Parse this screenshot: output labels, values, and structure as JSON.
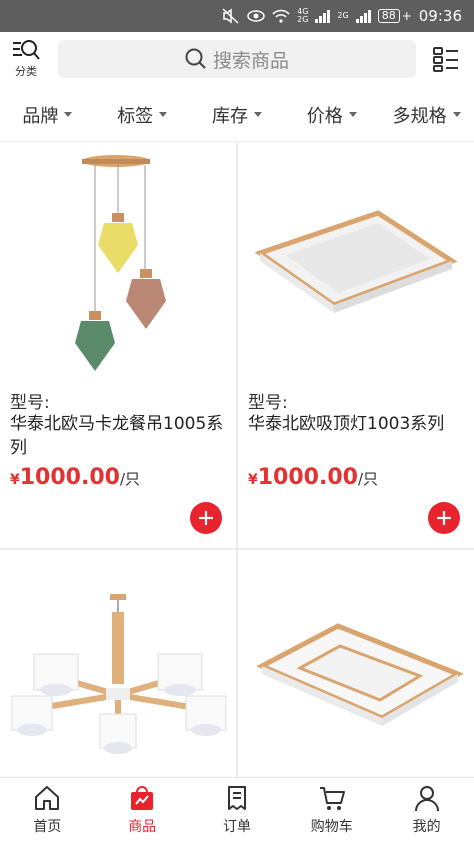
{
  "status_bar": {
    "network_top": "4G",
    "network_bottom": "2G",
    "network2": "2G",
    "battery": "88",
    "time": "09:36"
  },
  "header": {
    "category_label": "分类",
    "search_placeholder": "搜索商品"
  },
  "filters": [
    {
      "label": "品牌"
    },
    {
      "label": "标签"
    },
    {
      "label": "库存"
    },
    {
      "label": "价格"
    },
    {
      "label": "多规格"
    }
  ],
  "products": [
    {
      "model_label": "型号:",
      "name": "华泰北欧马卡龙餐吊1005系列",
      "currency": "¥",
      "price": "1000.00",
      "unit": "/只"
    },
    {
      "model_label": "型号:",
      "name": "华泰北欧吸顶灯1003系列",
      "currency": "¥",
      "price": "1000.00",
      "unit": "/只"
    },
    {
      "image": "chandelier-lamp"
    },
    {
      "image": "square-ceiling-lamp"
    }
  ],
  "tabs": [
    {
      "label": "首页",
      "icon": "home-icon"
    },
    {
      "label": "商品",
      "icon": "shopping-bag-icon"
    },
    {
      "label": "订单",
      "icon": "order-icon"
    },
    {
      "label": "购物车",
      "icon": "cart-icon"
    },
    {
      "label": "我的",
      "icon": "user-icon"
    }
  ],
  "colors": {
    "accent": "#e8232e",
    "price": "#e23232",
    "status_bar": "#5e5e5e"
  }
}
